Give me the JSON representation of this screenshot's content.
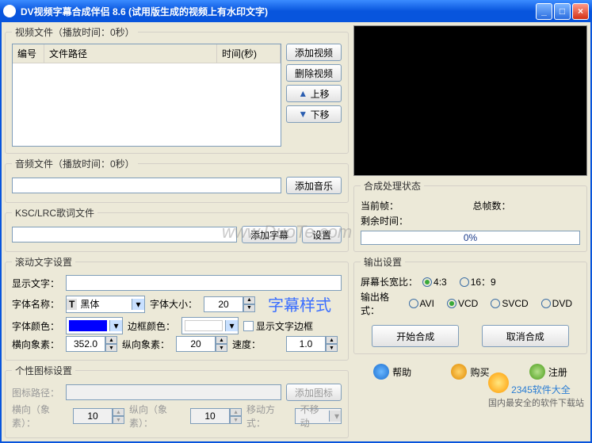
{
  "window": {
    "title": "DV视频字幕合成伴侣 8.6 (试用版生成的视频上有水印文字)"
  },
  "video_section": {
    "legend": "视频文件（播放时间：0秒）",
    "columns": {
      "num": "编号",
      "path": "文件路径",
      "time": "时间(秒)"
    },
    "buttons": {
      "add": "添加视频",
      "remove": "删除视频",
      "up": "上移",
      "down": "下移"
    }
  },
  "audio_section": {
    "legend": "音频文件（播放时间：0秒）",
    "add": "添加音乐",
    "value": ""
  },
  "lyric_section": {
    "legend": "KSC/LRC歌词文件",
    "add": "添加字幕",
    "settings": "设置",
    "value": ""
  },
  "scrolling": {
    "legend": "滚动文字设置",
    "display_label": "显示文字：",
    "display_value": "",
    "font_name_label": "字体名称：",
    "font_name_value": "黑体",
    "font_size_label": "字体大小：",
    "font_size_value": "20",
    "preview": "字幕样式",
    "font_color_label": "字体颜色：",
    "font_color_value": "#0000ff",
    "border_color_label": "边框颜色：",
    "border_color_value": "#ffffff",
    "show_border_label": "显示文字边框",
    "hpixel_label": "横向象素：",
    "hpixel_value": "352.0",
    "vpixel_label": "纵向象素：",
    "vpixel_value": "20",
    "speed_label": "速度：",
    "speed_value": "1.0"
  },
  "icon_section": {
    "legend": "个性图标设置",
    "icon_path_label": "图标路径：",
    "icon_path_value": "",
    "add_icon": "添加图标",
    "h_label": "横向（象素）：",
    "h_value": "10",
    "v_label": "纵向（象素）：",
    "v_value": "10",
    "move_label": "移动方式：",
    "move_value": "不移动"
  },
  "status": {
    "legend": "合成处理状态",
    "current_frame_label": "当前帧：",
    "total_frames_label": "总帧数：",
    "remain_time_label": "剩余时间：",
    "progress": "0%"
  },
  "output": {
    "legend": "输出设置",
    "aspect_label": "屏幕长宽比：",
    "aspect_options": [
      "4:3",
      "16：9"
    ],
    "format_label": "输出格式：",
    "format_options": [
      "AVI",
      "VCD",
      "SVCD",
      "DVD"
    ],
    "start": "开始合成",
    "cancel": "取消合成"
  },
  "links": {
    "help": "帮助",
    "buy": "购买",
    "register": "注册"
  },
  "watermark": "www.DuoTe.com",
  "logo_tag": "2345软件大全",
  "footer": "国内最安全的软件下载站"
}
